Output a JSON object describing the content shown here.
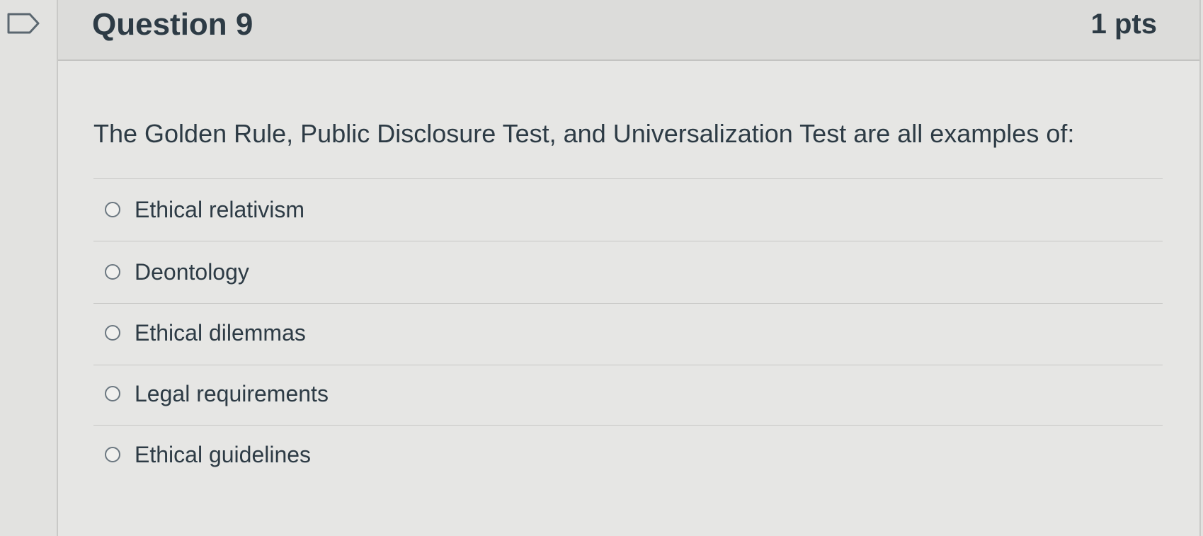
{
  "question": {
    "title": "Question 9",
    "points": "1 pts",
    "text": "The Golden Rule, Public Disclosure Test, and Universalization Test are all examples of:",
    "answers": [
      {
        "label": "Ethical relativism",
        "selected": false
      },
      {
        "label": "Deontology",
        "selected": false
      },
      {
        "label": "Ethical dilemmas",
        "selected": false
      },
      {
        "label": "Legal requirements",
        "selected": false
      },
      {
        "label": "Ethical guidelines",
        "selected": false
      }
    ]
  },
  "icons": {
    "flag": "flag-question-icon",
    "radio": "radio-unchecked-icon"
  },
  "colors": {
    "text": "#2d3b45",
    "header_bg": "#dcdcda",
    "body_bg": "#e6e6e4",
    "border": "#c3c3c1"
  }
}
